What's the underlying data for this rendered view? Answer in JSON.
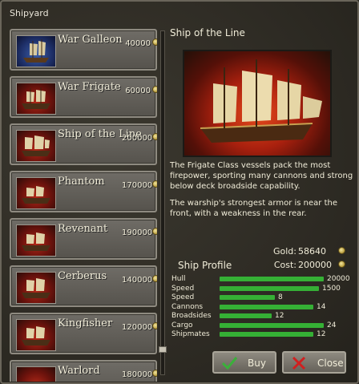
{
  "window": {
    "title": "Shipyard"
  },
  "ships": [
    {
      "name": "War Galleon",
      "price": "40000",
      "thumb": "blue"
    },
    {
      "name": "War Frigate",
      "price": "60000",
      "thumb": "red"
    },
    {
      "name": "Ship of the Line",
      "price": "200000",
      "thumb": "red"
    },
    {
      "name": "Phantom",
      "price": "170000",
      "thumb": "red"
    },
    {
      "name": "Revenant",
      "price": "190000",
      "thumb": "red"
    },
    {
      "name": "Cerberus",
      "price": "140000",
      "thumb": "red"
    },
    {
      "name": "Kingfisher",
      "price": "120000",
      "thumb": "red"
    },
    {
      "name": "Warlord",
      "price": "180000",
      "thumb": "red"
    }
  ],
  "detail": {
    "title": "Ship of the Line",
    "desc1": "The Frigate Class vessels pack the most firepower, sporting many cannons and strong below deck broadside capability.",
    "desc2": "The warship's strongest armor is near the front, with a weakness in the rear."
  },
  "gold": {
    "label": "Gold:",
    "value": "58640"
  },
  "cost": {
    "label": "Cost:",
    "value": "200000"
  },
  "profile": {
    "heading": "Ship Profile",
    "stats": [
      {
        "label": "Hull",
        "value": "20000",
        "fraction": 1.0
      },
      {
        "label": "Speed",
        "value": "1500",
        "fraction": 0.95
      },
      {
        "label": "Speed",
        "value": "8",
        "fraction": 0.53
      },
      {
        "label": "Cannons",
        "value": "14",
        "fraction": 0.9
      },
      {
        "label": "Broadsides",
        "value": "12",
        "fraction": 0.5
      },
      {
        "label": "Cargo",
        "value": "24",
        "fraction": 1.0
      },
      {
        "label": "Shipmates",
        "value": "12",
        "fraction": 0.9
      }
    ]
  },
  "buttons": {
    "buy": "Buy",
    "close": "Close"
  },
  "colors": {
    "bar": "#35b035",
    "frame": "#8e8a80"
  }
}
